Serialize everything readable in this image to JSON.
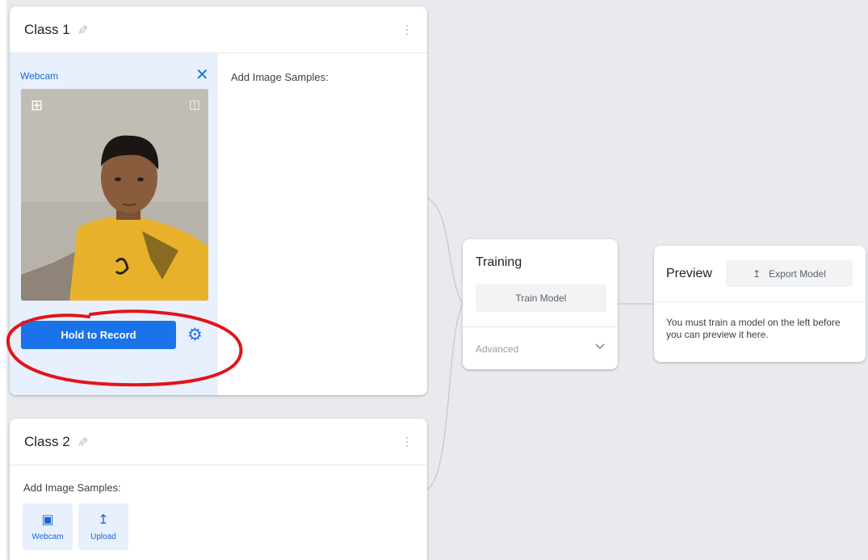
{
  "class1": {
    "title": "Class 1",
    "webcam_label": "Webcam",
    "samples_label": "Add Image Samples:",
    "record_label": "Hold to Record",
    "icons": {
      "pencil": "pencil-icon",
      "menu": "more-vert-icon",
      "close": "close-icon",
      "crop": "crop-icon",
      "flip": "flip-icon",
      "settings": "gear-icon"
    }
  },
  "class2": {
    "title": "Class 2",
    "samples_label": "Add Image Samples:",
    "webcam_button": "Webcam",
    "upload_button": "Upload"
  },
  "training": {
    "title": "Training",
    "train_button": "Train Model",
    "advanced_label": "Advanced"
  },
  "preview": {
    "title": "Preview",
    "export_button": "Export Model",
    "message": "You must train a model on the left before you can preview it here."
  },
  "colors": {
    "accent": "#1a73e8",
    "panel": "#e8f0fe",
    "annotation": "#e3141a",
    "background": "#e8eaed"
  }
}
